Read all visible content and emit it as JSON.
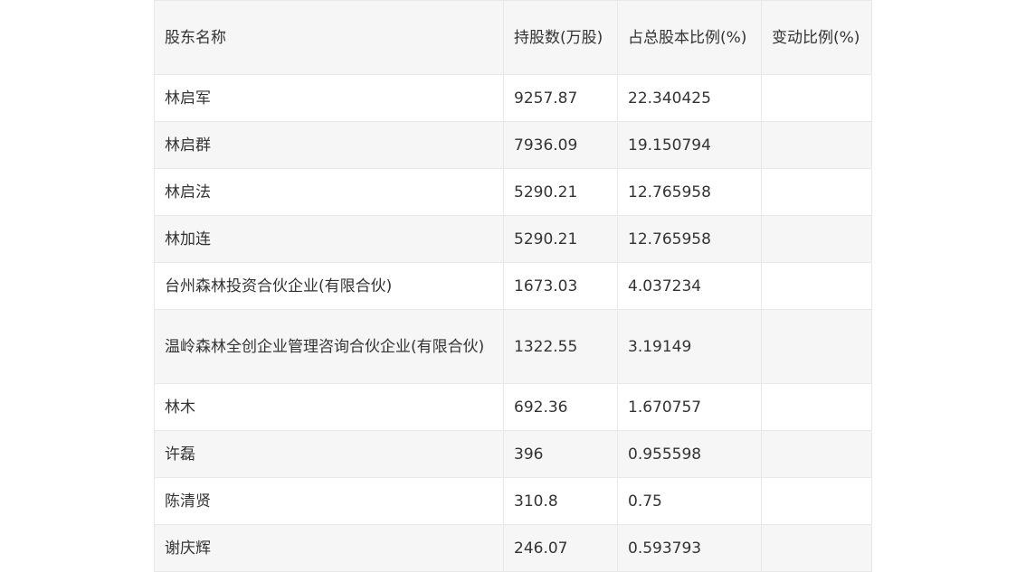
{
  "table": {
    "headers": [
      "股东名称",
      "持股数(万股)",
      "占总股本比例(%)",
      "变动比例(%)"
    ],
    "rows": [
      [
        "林启军",
        "9257.87",
        "22.340425",
        ""
      ],
      [
        "林启群",
        "7936.09",
        "19.150794",
        ""
      ],
      [
        "林启法",
        "5290.21",
        "12.765958",
        ""
      ],
      [
        "林加连",
        "5290.21",
        "12.765958",
        ""
      ],
      [
        "台州森林投资合伙企业(有限合伙)",
        "1673.03",
        "4.037234",
        ""
      ],
      [
        "温岭森林全创企业管理咨询合伙企业(有限合伙)",
        "1322.55",
        "3.19149",
        ""
      ],
      [
        "林木",
        "692.36",
        "1.670757",
        ""
      ],
      [
        "许磊",
        "396",
        "0.955598",
        ""
      ],
      [
        "陈清贤",
        "310.8",
        "0.75",
        ""
      ],
      [
        "谢庆辉",
        "246.07",
        "0.593793",
        ""
      ]
    ]
  }
}
